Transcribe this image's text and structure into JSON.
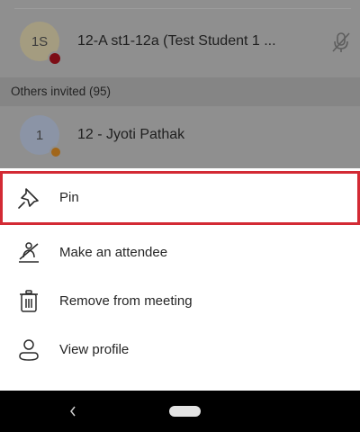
{
  "participants": [
    {
      "initials": "1S",
      "name": "12-A st1-12a (Test Student 1 ...",
      "status_color": "#7d0d16",
      "mic": "mic-off-icon"
    },
    {
      "initials": "1",
      "name": "12 - Jyoti Pathak",
      "status_color": "#a1661a"
    }
  ],
  "section": {
    "label": "Others invited (95)"
  },
  "menu": {
    "items": [
      {
        "label": "Pin",
        "icon": "pin-icon"
      },
      {
        "label": "Make an attendee",
        "icon": "make-attendee-icon"
      },
      {
        "label": "Remove from meeting",
        "icon": "trash-icon"
      },
      {
        "label": "View profile",
        "icon": "person-icon"
      }
    ],
    "highlight_color": "#d32a34"
  },
  "nav": {
    "back": "‹",
    "home": "home-pill-icon"
  }
}
